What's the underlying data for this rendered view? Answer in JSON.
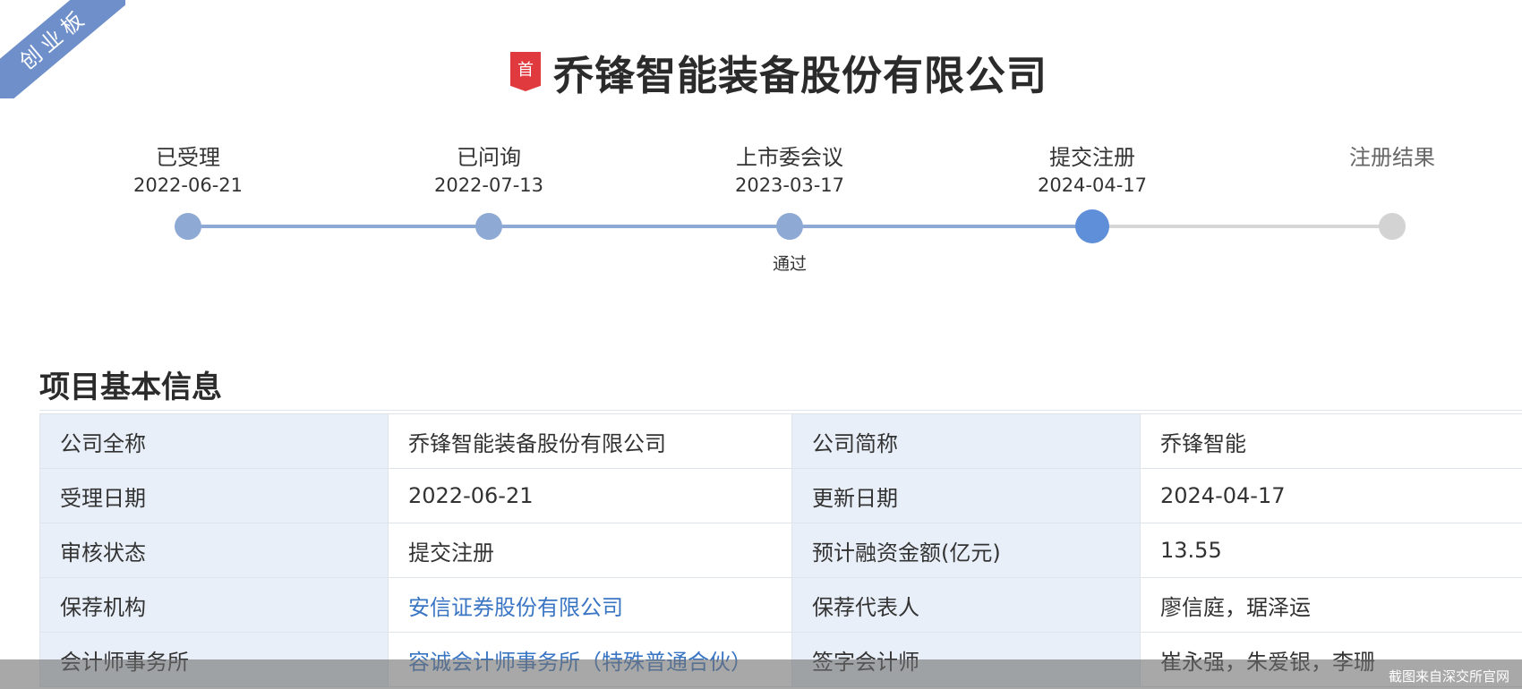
{
  "board_ribbon": "创业板",
  "title": {
    "badge": "首",
    "company_name": "乔锋智能装备股份有限公司"
  },
  "timeline": {
    "steps": [
      {
        "label": "已受理",
        "date": "2022-06-21",
        "status": "done"
      },
      {
        "label": "已问询",
        "date": "2022-07-13",
        "status": "done"
      },
      {
        "label": "上市委会议",
        "date": "2023-03-17",
        "status": "done",
        "result": "通过"
      },
      {
        "label": "提交注册",
        "date": "2024-04-17",
        "status": "current"
      },
      {
        "label": "注册结果",
        "date": "",
        "status": "pending"
      }
    ]
  },
  "section": {
    "title": "项目基本信息",
    "rows": [
      {
        "k1": "公司全称",
        "v1": "乔锋智能装备股份有限公司",
        "k2": "公司简称",
        "v2": "乔锋智能"
      },
      {
        "k1": "受理日期",
        "v1": "2022-06-21",
        "k2": "更新日期",
        "v2": "2024-04-17"
      },
      {
        "k1": "审核状态",
        "v1": "提交注册",
        "k2": "预计融资金额(亿元)",
        "v2": "13.55"
      },
      {
        "k1": "保荐机构",
        "v1": "安信证券股份有限公司",
        "k2": "保荐代表人",
        "v2": "廖信庭，琚泽运"
      },
      {
        "k1": "会计师事务所",
        "v1": "容诚会计师事务所（特殊普通合伙）",
        "k2": "签字会计师",
        "v2": "崔永强，朱爱银，李珊"
      }
    ]
  },
  "footer_note": "截图来自深交所官网",
  "colors": {
    "ribbon": "#6e8fc9",
    "badge": "#e03a3e",
    "timeline_done": "#8ea9d3",
    "timeline_current": "#5e8fd8",
    "timeline_pending": "#d3d3d3",
    "key_cell_bg": "#e9eff8",
    "link": "#3a75c4"
  }
}
